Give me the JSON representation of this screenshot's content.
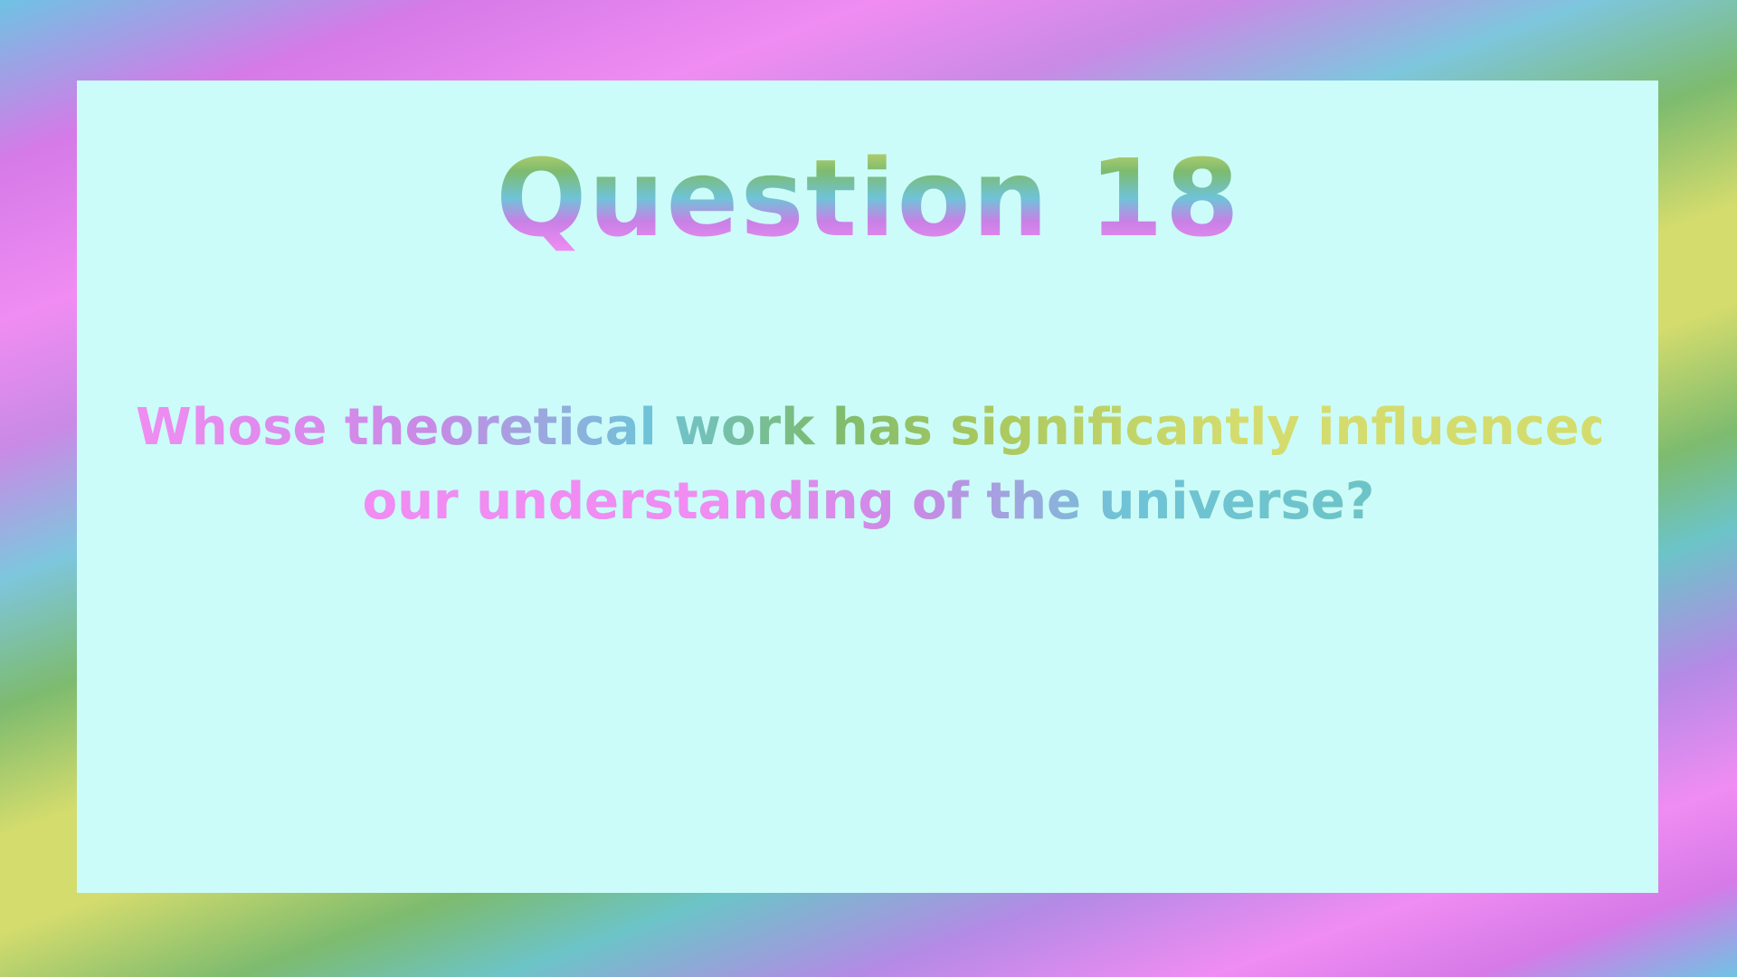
{
  "slide": {
    "title": "Question 18",
    "question_line_1": "Whose theoretical work has significantly influenced",
    "question_line_2": "our understanding of the universe?"
  },
  "colors": {
    "panel_background": "#ccfcf9",
    "pink": "#f08cf2",
    "purple": "#d57ae8",
    "blue": "#6fc3e3",
    "green": "#7dbb6f",
    "yellow": "#d4dc6d"
  }
}
